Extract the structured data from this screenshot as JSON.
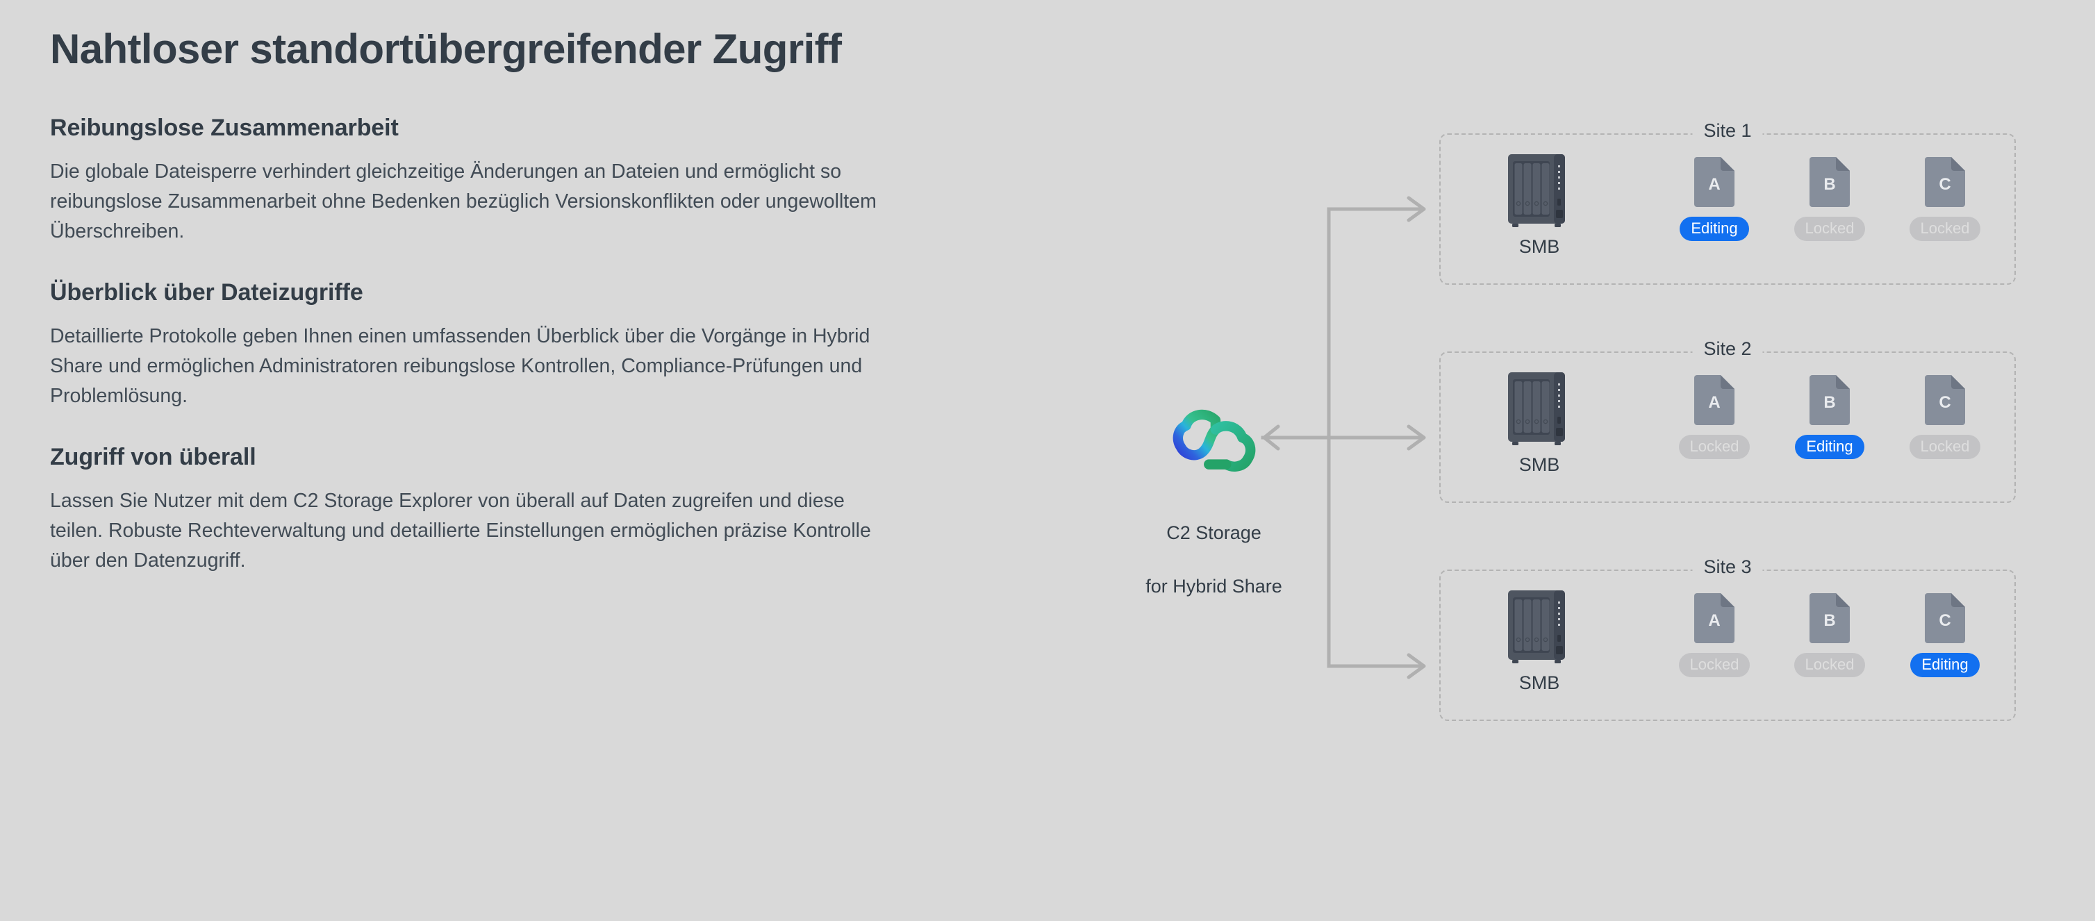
{
  "page": {
    "background_color": "#d9d9d9",
    "title": "Nahtloser standortübergreifender Zugriff"
  },
  "sections": [
    {
      "heading": "Reibungslose Zusammenarbeit",
      "body": "Die globale Dateisperre verhindert gleichzeitige Änderungen an Dateien und ermöglicht so reibungslose Zusammenarbeit ohne Bedenken bezüglich Versionskonflikten oder ungewolltem Überschreiben."
    },
    {
      "heading": "Überblick über Dateizugriffe",
      "body": "Detaillierte Protokolle geben Ihnen einen umfassenden Überblick über die Vorgänge in Hybrid Share und ermöglichen Administratoren reibungslose Kontrollen, Compliance-Prüfungen und Problemlösung."
    },
    {
      "heading": "Zugriff von überall",
      "body": "Lassen Sie Nutzer mit dem C2 Storage Explorer von überall auf Daten zugreifen und diese teilen. Robuste Rechteverwaltung und detaillierte Einstellungen ermöglichen präzise Kontrolle über den Datenzugriff."
    }
  ],
  "diagram": {
    "cloud": {
      "icon": "c2-cloud-logo-icon",
      "label": "C2 Storage\nfor Hybrid Share",
      "label_line_1": "C2 Storage",
      "label_line_2": "for Hybrid Share",
      "gradient_from": "#3b4de0",
      "gradient_mid": "#2cb7d9",
      "gradient_to": "#2fb97f"
    },
    "connector": {
      "color": "#b0b0b0",
      "arrow_to_cloud": "left-arrow-icon",
      "arrows_to_sites": "right-arrow-icon"
    },
    "badge_colors": {
      "editing": "#1270f0",
      "locked": "#c3c3c5"
    },
    "nas_color": "#4e5560",
    "file_color": "#868e9b",
    "sites": [
      {
        "label": "Site 1",
        "protocol": "SMB",
        "files": [
          {
            "name": "A",
            "status": "Editing",
            "state": "editing"
          },
          {
            "name": "B",
            "status": "Locked",
            "state": "locked"
          },
          {
            "name": "C",
            "status": "Locked",
            "state": "locked"
          }
        ]
      },
      {
        "label": "Site 2",
        "protocol": "SMB",
        "files": [
          {
            "name": "A",
            "status": "Locked",
            "state": "locked"
          },
          {
            "name": "B",
            "status": "Editing",
            "state": "editing"
          },
          {
            "name": "C",
            "status": "Locked",
            "state": "locked"
          }
        ]
      },
      {
        "label": "Site 3",
        "protocol": "SMB",
        "files": [
          {
            "name": "A",
            "status": "Locked",
            "state": "locked"
          },
          {
            "name": "B",
            "status": "Locked",
            "state": "locked"
          },
          {
            "name": "C",
            "status": "Editing",
            "state": "editing"
          }
        ]
      }
    ]
  }
}
